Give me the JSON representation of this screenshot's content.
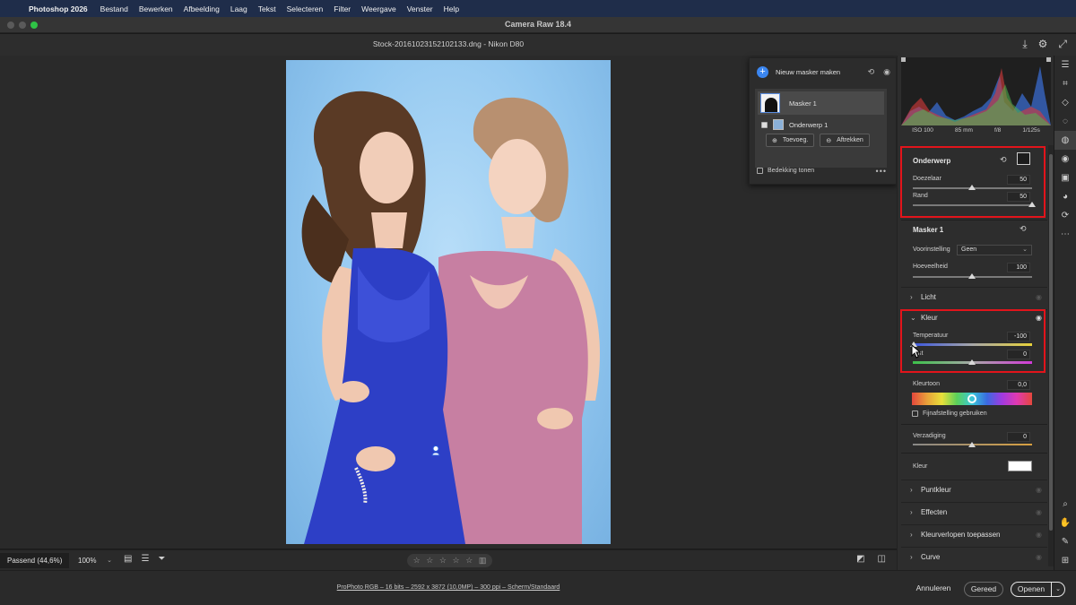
{
  "menubar": {
    "app": "Photoshop 2026",
    "items": [
      "Bestand",
      "Bewerken",
      "Afbeelding",
      "Laag",
      "Tekst",
      "Selecteren",
      "Filter",
      "Weergave",
      "Venster",
      "Help"
    ]
  },
  "window": {
    "title": "Camera Raw 18.4"
  },
  "file": {
    "title": "Stock-20161023152102133.dng  -  Nikon D80"
  },
  "mask_panel": {
    "create_label": "Nieuw masker maken",
    "masks": [
      {
        "label": "Masker 1"
      }
    ],
    "components": [
      {
        "label": "Onderwerp 1"
      }
    ],
    "add_label": "Toevoeg.",
    "subtract_label": "Aftrekken",
    "overlay_label": "Bedekking tonen"
  },
  "exif": {
    "iso": "ISO 100",
    "focal": "85 mm",
    "aperture": "f/8",
    "shutter": "1/125s"
  },
  "subject_section": {
    "title": "Onderwerp",
    "sliders": [
      {
        "label": "Doezelaar",
        "value": "50",
        "pos": 0.5
      },
      {
        "label": "Rand",
        "value": "50",
        "pos": 1.0
      }
    ]
  },
  "mask1_section": {
    "title": "Masker 1",
    "preset_label": "Voorinstelling",
    "preset_value": "Geen",
    "amount_label": "Hoeveelheid",
    "amount_value": "100"
  },
  "light_section": {
    "title": "Licht"
  },
  "color_section": {
    "title": "Kleur",
    "temperature_label": "Temperatuur",
    "temperature_value": "-100",
    "tint_label": "Tint",
    "tint_value": "0",
    "hue_label": "Kleurtoon",
    "hue_value": "0,0",
    "fine_tune_label": "Fijnafstelling gebruiken",
    "saturation_label": "Verzadiging",
    "saturation_value": "0",
    "color_label": "Kleur"
  },
  "collapsed_sections": [
    "Puntkleur",
    "Effecten",
    "Kleurverlopen toepassen",
    "Curve"
  ],
  "bottombar": {
    "fit": "Passend (44,6%)",
    "zoom": "100%"
  },
  "footer": {
    "info": "ProPhoto RGB – 16 bits – 2592 x 3872 (10,0MP) – 300 ppi – Scherm/Standaard",
    "cancel": "Annuleren",
    "done": "Gereed",
    "open": "Openen"
  },
  "colors": {
    "accent": "#3b86f0",
    "highlight_box": "#e2141b",
    "menubar": "#1f2d4a"
  }
}
